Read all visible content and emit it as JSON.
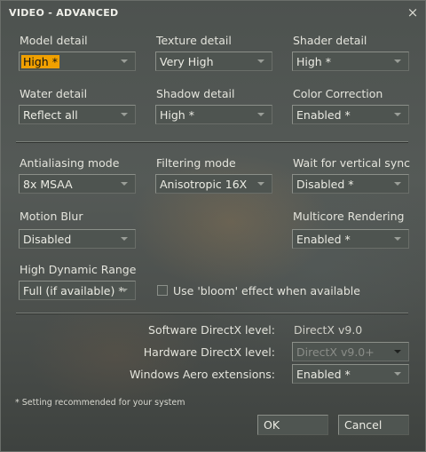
{
  "window": {
    "title": "VIDEO - ADVANCED",
    "close_glyph": "×"
  },
  "row1": {
    "model": {
      "label": "Model detail",
      "value": "High *"
    },
    "texture": {
      "label": "Texture detail",
      "value": "Very High"
    },
    "shader": {
      "label": "Shader detail",
      "value": "High *"
    }
  },
  "row2": {
    "water": {
      "label": "Water detail",
      "value": "Reflect all"
    },
    "shadow": {
      "label": "Shadow detail",
      "value": "High *"
    },
    "color": {
      "label": "Color Correction",
      "value": "Enabled *"
    }
  },
  "row3": {
    "aa": {
      "label": "Antialiasing mode",
      "value": "8x MSAA"
    },
    "filter": {
      "label": "Filtering mode",
      "value": "Anisotropic 16X"
    },
    "vsync": {
      "label": "Wait for vertical sync",
      "value": "Disabled *"
    }
  },
  "row4": {
    "motion": {
      "label": "Motion Blur",
      "value": "Disabled"
    },
    "multicore": {
      "label": "Multicore Rendering",
      "value": "Enabled *"
    }
  },
  "row5": {
    "hdr": {
      "label": "High Dynamic Range",
      "value": "Full (if available) *"
    },
    "bloom": {
      "label": "Use 'bloom' effect when available",
      "checked": false
    }
  },
  "directx": {
    "software_label": "Software DirectX level:",
    "software_value": "DirectX v9.0",
    "hardware_label": "Hardware DirectX level:",
    "hardware_value": "DirectX v9.0+",
    "aero_label": "Windows Aero extensions:",
    "aero_value": "Enabled *"
  },
  "footnote": "* Setting recommended for your system",
  "buttons": {
    "ok": "OK",
    "cancel": "Cancel"
  },
  "colors": {
    "selection": "#f0a000",
    "panel": "#4e5450"
  }
}
